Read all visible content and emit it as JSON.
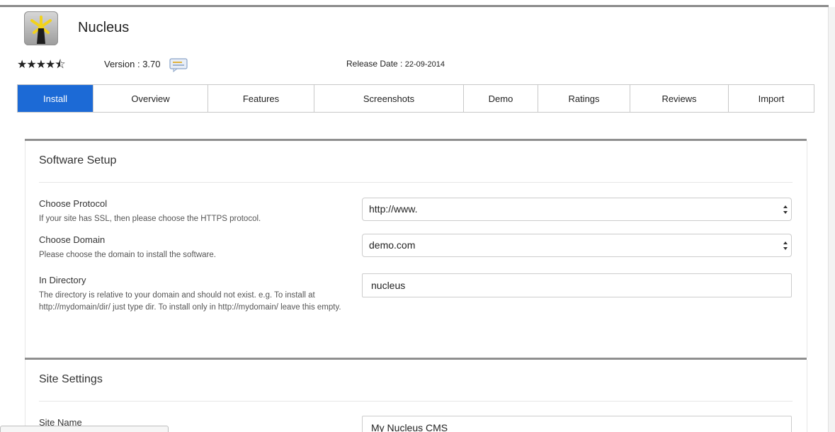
{
  "app": {
    "title": "Nucleus",
    "rating_stars": "★★★★⯪",
    "version_label": "Version : ",
    "version_value": "3.70",
    "release_label": "Release Date : ",
    "release_value": "22-09-2014"
  },
  "tabs": [
    {
      "label": "Install",
      "active": true
    },
    {
      "label": "Overview",
      "active": false
    },
    {
      "label": "Features",
      "active": false
    },
    {
      "label": "Screenshots",
      "active": false
    },
    {
      "label": "Demo",
      "active": false
    },
    {
      "label": "Ratings",
      "active": false
    },
    {
      "label": "Reviews",
      "active": false
    },
    {
      "label": "Import",
      "active": false
    }
  ],
  "software_setup": {
    "title": "Software Setup",
    "protocol": {
      "label": "Choose Protocol",
      "help": "If your site has SSL, then please choose the HTTPS protocol.",
      "value": "http://www."
    },
    "domain": {
      "label": "Choose Domain",
      "help": "Please choose the domain to install the software.",
      "value": "demo.com"
    },
    "directory": {
      "label": "In Directory",
      "help": "The directory is relative to your domain and should not exist. e.g. To install at http://mydomain/dir/ just type dir. To install only in http://mydomain/ leave this empty.",
      "value": "nucleus"
    }
  },
  "site_settings": {
    "title": "Site Settings",
    "site_name": {
      "label": "Site Name",
      "value": "My Nucleus CMS"
    }
  },
  "colors": {
    "active_tab": "#1c6ad6",
    "logo_accent": "#f2d21b"
  }
}
